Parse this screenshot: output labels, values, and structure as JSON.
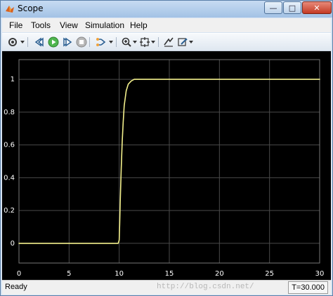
{
  "window": {
    "title": "Scope"
  },
  "menu": {
    "items": [
      {
        "label": "File"
      },
      {
        "label": "Tools"
      },
      {
        "label": "View"
      },
      {
        "label": "Simulation"
      },
      {
        "label": "Help"
      }
    ]
  },
  "toolbar": {
    "icons": [
      "settings-gear-icon",
      "step-back-icon",
      "run-icon",
      "step-forward-icon",
      "stop-icon",
      "signal-selector-icon",
      "zoom-in-icon",
      "zoom-fit-icon",
      "cursor-measure-icon",
      "style-edit-icon"
    ]
  },
  "status": {
    "left": "Ready",
    "watermark": "http://blog.csdn.net/",
    "time": "T=30.000"
  },
  "colors": {
    "plot_background": "#000000",
    "grid": "#4a4a4a",
    "trace": "#f3f08c",
    "axis_text": "#ffffff"
  },
  "chart_data": {
    "type": "line",
    "xlim": [
      0,
      30
    ],
    "ylim": [
      -0.12,
      1.12
    ],
    "x_ticks": [
      "0",
      "5",
      "10",
      "15",
      "20",
      "25",
      "30"
    ],
    "y_ticks": [
      "0",
      "0.2",
      "0.4",
      "0.6",
      "0.8",
      "1"
    ],
    "grid": true,
    "series": [
      {
        "x": [
          0,
          9.9,
          10.0,
          10.05,
          10.1,
          10.2,
          10.3,
          10.4,
          10.5,
          10.7,
          10.9,
          11.2,
          11.5,
          12.0,
          30.0
        ],
        "y": [
          0,
          0,
          0.02,
          0.12,
          0.25,
          0.45,
          0.62,
          0.74,
          0.84,
          0.93,
          0.97,
          0.99,
          1.0,
          1.0,
          1.0
        ]
      }
    ]
  }
}
